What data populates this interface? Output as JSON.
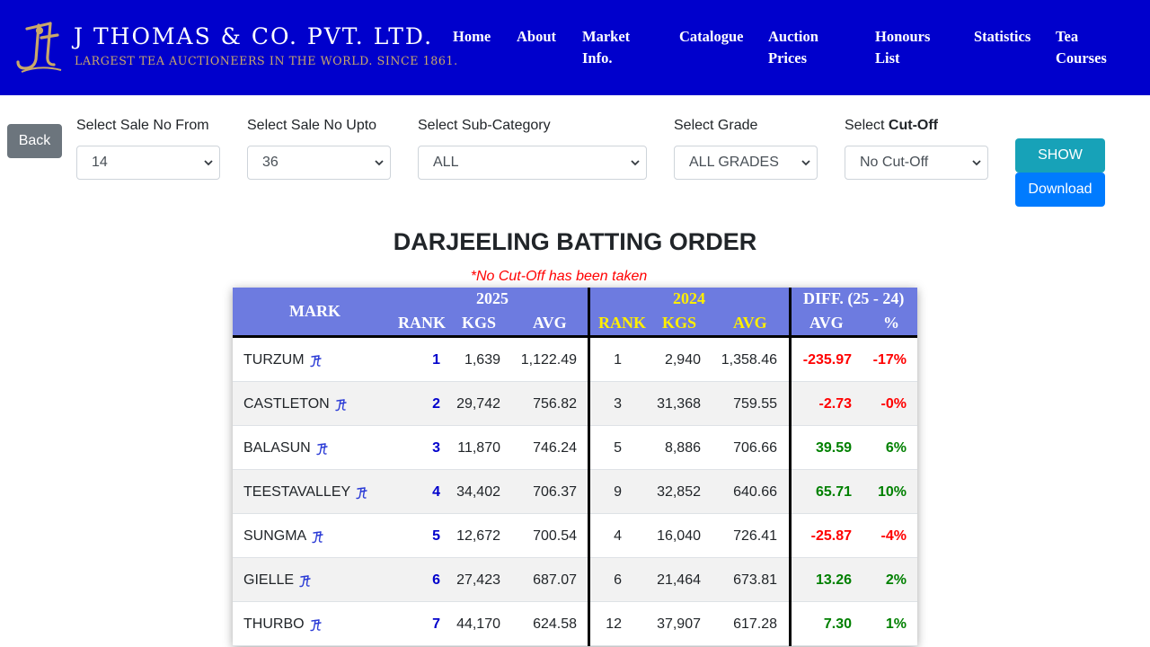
{
  "brand": {
    "title": "J THOMAS & CO. PVT. LTD.",
    "subtitle": "LARGEST TEA AUCTIONEERS IN THE WORLD. SINCE 1861.",
    "logo_icon": "jt-monogram-icon",
    "gold": "#c9a86a",
    "header_bg": "#0000cc"
  },
  "nav": [
    {
      "line1": "Home",
      "line2": ""
    },
    {
      "line1": "About",
      "line2": ""
    },
    {
      "line1": "Market",
      "line2": "Info."
    },
    {
      "line1": "Catalogue",
      "line2": ""
    },
    {
      "line1": "Auction",
      "line2": "Prices"
    },
    {
      "line1": "Honours",
      "line2": "List"
    },
    {
      "line1": "Statistics",
      "line2": ""
    },
    {
      "line1": "Tea",
      "line2": "Courses"
    }
  ],
  "filters": {
    "back_label": "Back",
    "sale_from": {
      "label": "Select Sale No From",
      "value": "14"
    },
    "sale_upto": {
      "label": "Select Sale No Upto",
      "value": "36"
    },
    "sub_category": {
      "label": "Select Sub-Category",
      "value": "ALL"
    },
    "grade": {
      "label": "Select Grade",
      "value": "ALL GRADES"
    },
    "cutoff": {
      "label_prefix": "Select ",
      "label_bold": "Cut-Off",
      "value": "No Cut-Off"
    },
    "show_label": "SHOW",
    "download_label": "Download"
  },
  "report": {
    "title": "DARJEELING BATTING ORDER",
    "note": "*No Cut-Off has been taken"
  },
  "table": {
    "header": {
      "mark": "MARK",
      "year_current": "2025",
      "year_previous": "2024",
      "diff": "DIFF. (25 - 24)",
      "rank": "RANK",
      "kgs": "KGS",
      "avg": "AVG",
      "pct": "%"
    },
    "rows": [
      {
        "mark": "TURZUM",
        "rank25": "1",
        "kgs25": "1,639",
        "avg25": "1,122.49",
        "rank24": "1",
        "kgs24": "2,940",
        "avg24": "1,358.46",
        "diff_avg": "-235.97",
        "diff_pct": "-17%",
        "trend": "neg"
      },
      {
        "mark": "CASTLETON",
        "rank25": "2",
        "kgs25": "29,742",
        "avg25": "756.82",
        "rank24": "3",
        "kgs24": "31,368",
        "avg24": "759.55",
        "diff_avg": "-2.73",
        "diff_pct": "-0%",
        "trend": "neg"
      },
      {
        "mark": "BALASUN",
        "rank25": "3",
        "kgs25": "11,870",
        "avg25": "746.24",
        "rank24": "5",
        "kgs24": "8,886",
        "avg24": "706.66",
        "diff_avg": "39.59",
        "diff_pct": "6%",
        "trend": "pos"
      },
      {
        "mark": "TEESTAVALLEY",
        "rank25": "4",
        "kgs25": "34,402",
        "avg25": "706.37",
        "rank24": "9",
        "kgs24": "32,852",
        "avg24": "640.66",
        "diff_avg": "65.71",
        "diff_pct": "10%",
        "trend": "pos"
      },
      {
        "mark": "SUNGMA",
        "rank25": "5",
        "kgs25": "12,672",
        "avg25": "700.54",
        "rank24": "4",
        "kgs24": "16,040",
        "avg24": "726.41",
        "diff_avg": "-25.87",
        "diff_pct": "-4%",
        "trend": "neg"
      },
      {
        "mark": "GIELLE",
        "rank25": "6",
        "kgs25": "27,423",
        "avg25": "687.07",
        "rank24": "6",
        "kgs24": "21,464",
        "avg24": "673.81",
        "diff_avg": "13.26",
        "diff_pct": "2%",
        "trend": "pos"
      },
      {
        "mark": "THURBO",
        "rank25": "7",
        "kgs25": "44,170",
        "avg25": "624.58",
        "rank24": "12",
        "kgs24": "37,907",
        "avg24": "617.28",
        "diff_avg": "7.30",
        "diff_pct": "1%",
        "trend": "pos"
      }
    ],
    "mark_icon": "jt-mini-logo-icon",
    "colors": {
      "header_bg": "#6d7be0",
      "rank_blue": "#0000cc",
      "negative": "#ff0000",
      "positive": "#008000",
      "year_2024": "#ffee00"
    }
  }
}
